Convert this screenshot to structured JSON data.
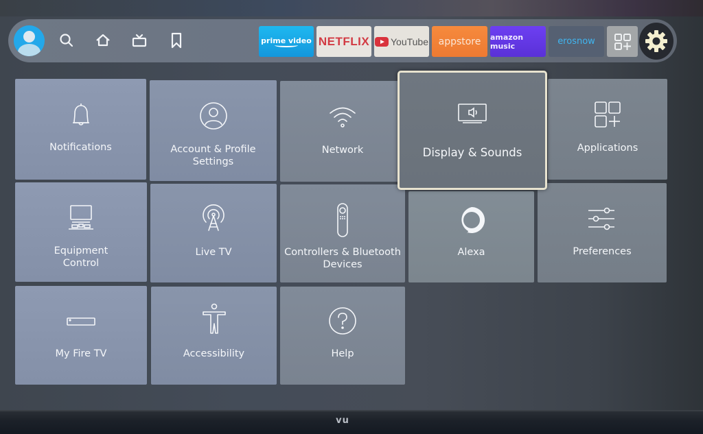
{
  "device": {
    "brand": "vu"
  },
  "navbar": {
    "icons": [
      {
        "name": "search",
        "label": "Search"
      },
      {
        "name": "home",
        "label": "Home"
      },
      {
        "name": "live-tv",
        "label": "Live"
      },
      {
        "name": "bookmark",
        "label": "My Stuff"
      }
    ],
    "apps": [
      {
        "id": "prime-video",
        "label": "prime video",
        "color": "#1ba5e6"
      },
      {
        "id": "netflix",
        "label": "NETFLIX",
        "color": "#d23a43"
      },
      {
        "id": "youtube",
        "label": "YouTube",
        "color": "#d9333d"
      },
      {
        "id": "appstore",
        "label": "appstore",
        "color": "#f08235"
      },
      {
        "id": "amazon-music",
        "label": "amazon music",
        "color": "#6338e6"
      },
      {
        "id": "erosnow",
        "label": "erosnow",
        "color": "#40b5f0"
      }
    ],
    "all_apps_label": "All Apps",
    "settings_label": "Settings"
  },
  "settings": {
    "focused_item": "Display & Sounds",
    "items": [
      {
        "id": "notifications",
        "label": "Notifications",
        "icon": "bell-icon"
      },
      {
        "id": "account",
        "label": "Account & Profile Settings",
        "line1": "Account & Profile",
        "line2": "Settings",
        "icon": "user-circle-icon"
      },
      {
        "id": "network",
        "label": "Network",
        "icon": "wifi-icon"
      },
      {
        "id": "display-sounds",
        "label": "Display & Sounds",
        "icon": "tv-speaker-icon"
      },
      {
        "id": "applications",
        "label": "Applications",
        "icon": "apps-add-icon"
      },
      {
        "id": "equipment",
        "label": "Equipment Control",
        "line1": "Equipment",
        "line2": "Control",
        "icon": "equipment-icon"
      },
      {
        "id": "live-tv",
        "label": "Live TV",
        "icon": "antenna-icon"
      },
      {
        "id": "controllers",
        "label": "Controllers & Bluetooth Devices",
        "line1": "Controllers & Bluetooth",
        "line2": "Devices",
        "icon": "remote-icon"
      },
      {
        "id": "alexa",
        "label": "Alexa",
        "icon": "alexa-icon"
      },
      {
        "id": "preferences",
        "label": "Preferences",
        "icon": "sliders-icon"
      },
      {
        "id": "my-fire-tv",
        "label": "My Fire TV",
        "icon": "fire-stick-icon"
      },
      {
        "id": "accessibility",
        "label": "Accessibility",
        "icon": "accessibility-icon"
      },
      {
        "id": "help",
        "label": "Help",
        "icon": "help-icon"
      }
    ]
  }
}
